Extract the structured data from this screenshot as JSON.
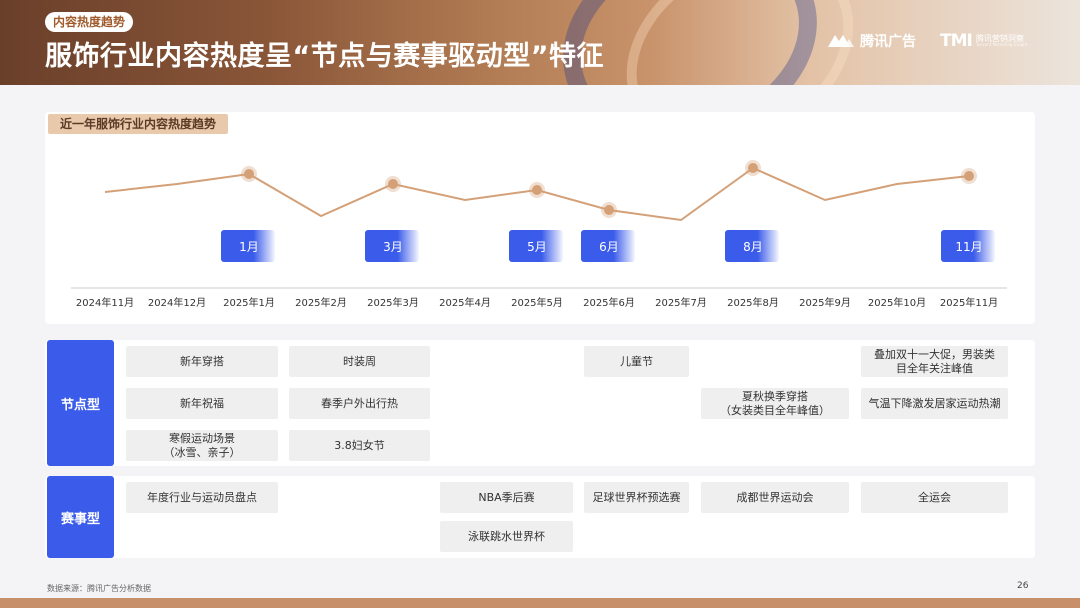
{
  "header": {
    "tag": "内容热度趋势",
    "title": "服饰行业内容热度呈“节点与赛事驱动型”特征",
    "logo1_text": "腾讯广告",
    "logo2_mark": "TMI",
    "logo2_cn": "腾讯营销洞察",
    "logo2_en": "Tencent Marketing Insight"
  },
  "chart_panel": {
    "label": "近一年服饰行业内容热度趋势"
  },
  "chart_data": {
    "type": "line",
    "categories": [
      "2024年11月",
      "2024年12月",
      "2025年1月",
      "2025年2月",
      "2025年3月",
      "2025年4月",
      "2025年5月",
      "2025年6月",
      "2025年7月",
      "2025年8月",
      "2025年9月",
      "2025年10月",
      "2025年11月"
    ],
    "values": [
      6.2,
      6.6,
      7.1,
      5.0,
      6.6,
      5.8,
      6.3,
      5.3,
      4.8,
      7.4,
      5.8,
      6.6,
      7.0
    ],
    "highlighted_indices": [
      2,
      4,
      6,
      7,
      9,
      12
    ],
    "highlight_labels": [
      "1月",
      "3月",
      "5月",
      "6月",
      "8月",
      "11月"
    ],
    "line_color": "#d4a078",
    "marker_color": "#d4a078",
    "badge_color": "#3b5bea"
  },
  "rows": {
    "node": {
      "label": "节点型",
      "cells": [
        "新年穿搭",
        "新年祝福",
        "寒假运动场景\n（冰雪、亲子）",
        "时装周",
        "春季户外出行热",
        "3.8妇女节",
        "儿童节",
        "夏秋换季穿搭\n（女装类目全年峰值）",
        "叠加双十一大促，男装类\n目全年关注峰值",
        "气温下降激发居家运动热潮"
      ]
    },
    "event": {
      "label": "赛事型",
      "cells": [
        "年度行业与运动员盘点",
        "NBA季后赛",
        "泳联跳水世界杯",
        "足球世界杯预选赛",
        "成都世界运动会",
        "全运会"
      ]
    }
  },
  "footer": {
    "source": "数据来源：腾讯广告分析数据",
    "page": "26"
  },
  "colors": {
    "accent": "#3b5bea",
    "brand": "#c8906a"
  }
}
